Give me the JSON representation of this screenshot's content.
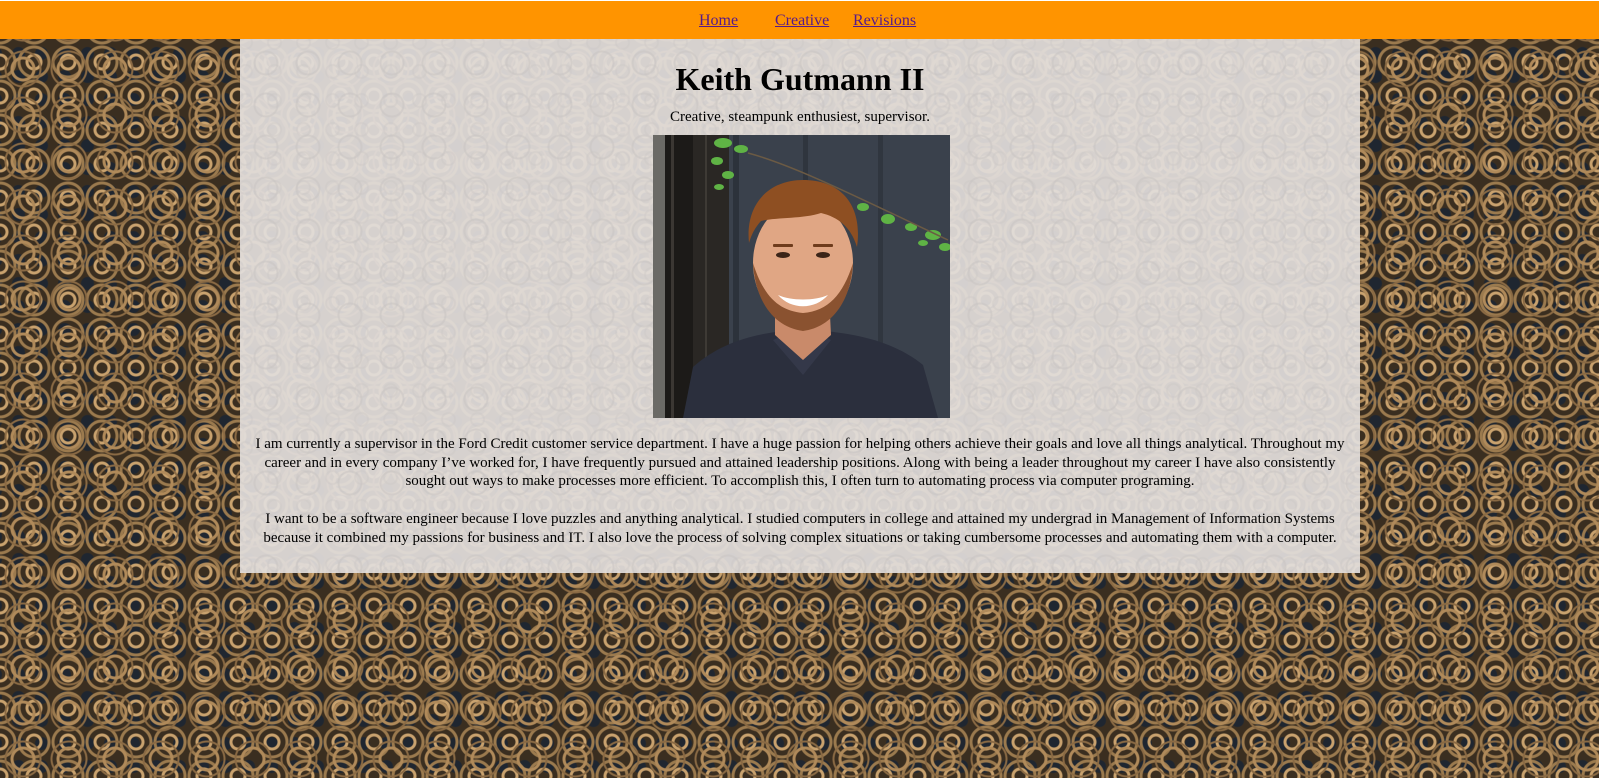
{
  "nav": {
    "home": "Home",
    "creative": "Creative",
    "revisions": "Revisions"
  },
  "profile": {
    "name": "Keith Gutmann II",
    "tagline": "Creative, steampunk enthusiest, supervisor.",
    "photo_alt": "Portrait photo",
    "bio_1": "I am currently a supervisor in the Ford Credit customer service department. I have a huge passion for helping others achieve their goals and love all things analytical. Throughout my career and in every company I’ve worked for, I have frequently pursued and attained leadership positions. Along with being a leader throughout my career I have also consistently sought out ways to make processes more efficient. To accomplish this, I often turn to automating process via computer programing.",
    "bio_2": "I want to be a software engineer because I love puzzles and anything analytical. I studied computers in college and attained my undergrad in Management of Information Systems because it combined my passions for business and IT. I also love the process of solving complex situations or taking cumbersome processes and automating them with a computer."
  },
  "colors": {
    "nav_bar": "#ff9400",
    "link": "#551a8b",
    "panel": "#e2dedc"
  }
}
